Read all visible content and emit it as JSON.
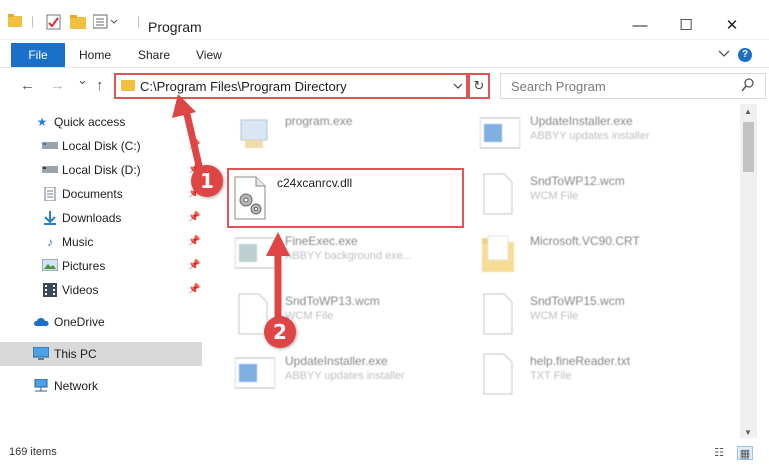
{
  "window": {
    "title": "Program",
    "controls": {
      "minimize": "—",
      "maximize": "☐",
      "close": "✕"
    }
  },
  "ribbon": {
    "tabs": [
      "File",
      "Home",
      "Share",
      "View"
    ],
    "expand_icon": "chevron-down-icon",
    "help": "?"
  },
  "navigation": {
    "back": "←",
    "forward": "→",
    "recent": "⌄",
    "up": "↑",
    "address": "C:\\Program Files\\Program Directory",
    "refresh": "↻",
    "search_placeholder": "Search Program"
  },
  "sidebar": {
    "items": [
      {
        "label": "Quick access",
        "icon": "star-icon",
        "pinned": false
      },
      {
        "label": "Local Disk (C:)",
        "icon": "drive-icon",
        "pinned": true
      },
      {
        "label": "Local Disk (D:)",
        "icon": "drive-icon",
        "pinned": true
      },
      {
        "label": "Documents",
        "icon": "documents-icon",
        "pinned": true
      },
      {
        "label": "Downloads",
        "icon": "downloads-icon",
        "pinned": true
      },
      {
        "label": "Music",
        "icon": "music-icon",
        "pinned": true
      },
      {
        "label": "Pictures",
        "icon": "pictures-icon",
        "pinned": true
      },
      {
        "label": "Videos",
        "icon": "videos-icon",
        "pinned": true
      },
      {
        "label": "OneDrive",
        "icon": "onedrive-icon",
        "pinned": false
      },
      {
        "label": "This PC",
        "icon": "this-pc-icon",
        "pinned": false,
        "selected": true
      },
      {
        "label": "Network",
        "icon": "network-icon",
        "pinned": false
      }
    ]
  },
  "files": [
    {
      "name": "program.exe",
      "type": "",
      "icon": "exe-icon"
    },
    {
      "name": "UpdateInstaller.exe",
      "type": "ABBYY updates installer",
      "icon": "installer-icon"
    },
    {
      "name": "c24xcanrcv.dll",
      "type": "",
      "icon": "dll-gear-icon",
      "selected": true
    },
    {
      "name": "SndToWP12.wcm",
      "type": "WCM File",
      "icon": "generic-file-icon"
    },
    {
      "name": "FineExec.exe",
      "type": "ABBYY background exe...",
      "icon": "exe-icon"
    },
    {
      "name": "Microsoft.VC90.CRT",
      "type": "",
      "icon": "folder-icon"
    },
    {
      "name": "SndToWP13.wcm",
      "type": "WCM File",
      "icon": "generic-file-icon"
    },
    {
      "name": "SndToWP15.wcm",
      "type": "WCM File",
      "icon": "generic-file-icon"
    },
    {
      "name": "UpdateInstaller.exe",
      "type": "ABBYY updates installer",
      "icon": "installer-icon"
    },
    {
      "name": "help.fineReader.txt",
      "type": "TXT File",
      "icon": "text-file-icon"
    }
  ],
  "status": {
    "item_count": "169 items"
  },
  "annotations": [
    {
      "label": "1"
    },
    {
      "label": "2"
    }
  ],
  "colors": {
    "accent": "#1a6fc9",
    "annotation_red": "#e04545",
    "highlight_border": "#e05656"
  }
}
